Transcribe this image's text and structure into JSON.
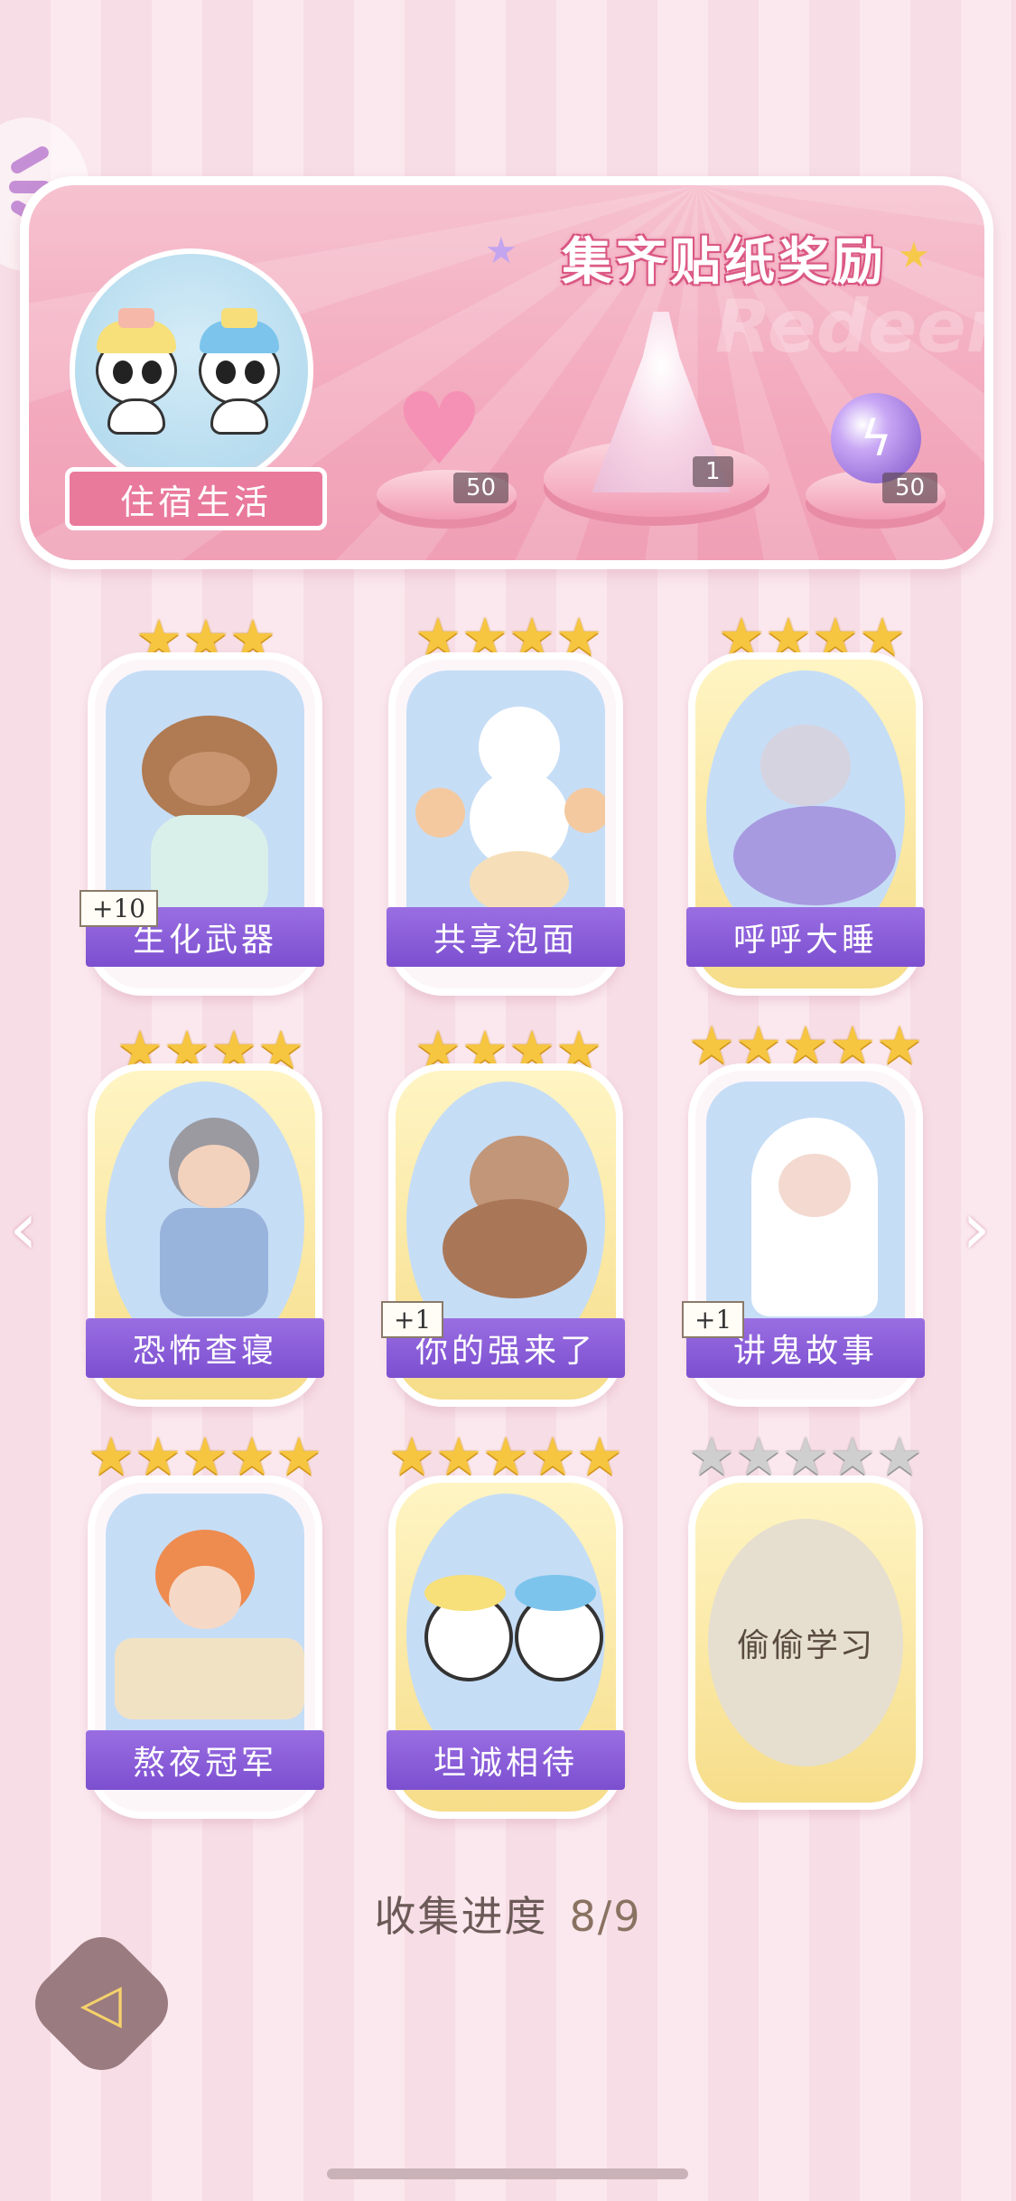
{
  "banner": {
    "title": "集齐贴纸奖励",
    "watermark": "Redeem",
    "theme_label": "住宿生活",
    "rewards": [
      {
        "icon": "heart-gem-icon",
        "count": "50"
      },
      {
        "icon": "dress-outfit-icon",
        "count": "1"
      },
      {
        "icon": "energy-orb-icon",
        "count": "50"
      }
    ]
  },
  "stickers": [
    {
      "label": "生化武器",
      "stars": 3,
      "frame": "silver",
      "bonus": "+10",
      "collected": true,
      "art": "capybara"
    },
    {
      "label": "共享泡面",
      "stars": 4,
      "frame": "silver",
      "bonus": "",
      "collected": true,
      "art": "bunny-noodles"
    },
    {
      "label": "呼呼大睡",
      "stars": 4,
      "frame": "gold",
      "bonus": "",
      "collected": true,
      "art": "sleeping-boy"
    },
    {
      "label": "恐怖查寝",
      "stars": 4,
      "frame": "gold",
      "bonus": "",
      "collected": true,
      "art": "dorm-auntie"
    },
    {
      "label": "你的强来了",
      "stars": 4,
      "frame": "gold",
      "bonus": "+1",
      "collected": true,
      "art": "cockroach"
    },
    {
      "label": "讲鬼故事",
      "stars": 5,
      "frame": "silver",
      "bonus": "+1",
      "collected": true,
      "art": "ghost-boy"
    },
    {
      "label": "熬夜冠军",
      "stars": 5,
      "frame": "silver",
      "bonus": "",
      "collected": true,
      "art": "late-night-boy"
    },
    {
      "label": "坦诚相待",
      "stars": 5,
      "frame": "gold",
      "bonus": "",
      "collected": true,
      "art": "pandas-bath"
    },
    {
      "label": "偷偷学习",
      "stars": 5,
      "frame": "locked",
      "bonus": "",
      "collected": false,
      "art": ""
    }
  ],
  "progress": {
    "label": "收集进度",
    "value": "8/9"
  },
  "nav": {
    "prev_icon": "chevron-left-icon",
    "next_icon": "chevron-right-icon",
    "back_icon": "back-arrow-icon"
  },
  "colors": {
    "accent_purple": "#7c4fd0",
    "banner_pink": "#f3a9bd",
    "gold_star": "#f7c640"
  }
}
